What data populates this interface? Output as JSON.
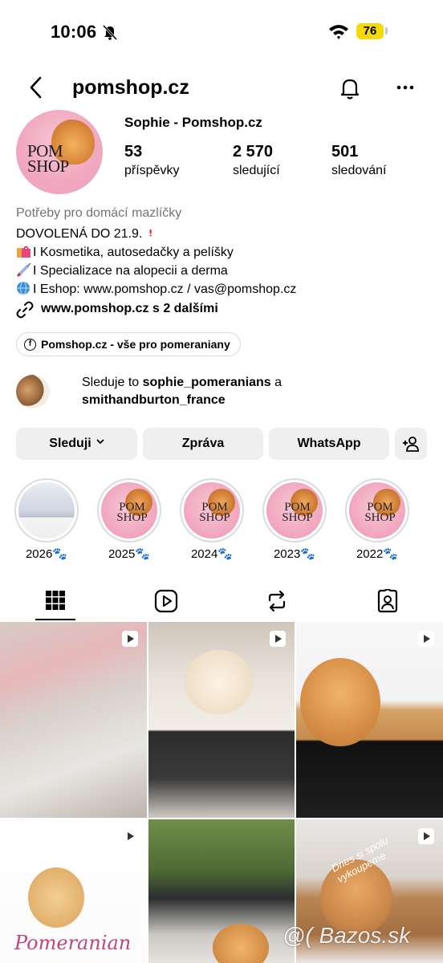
{
  "status_bar": {
    "time": "10:06",
    "battery": "76"
  },
  "header": {
    "username": "pomshop.cz"
  },
  "profile": {
    "avatar_text": "POM SHOP",
    "display_name": "Sophie - Pomshop.cz",
    "stats": [
      {
        "num": "53",
        "label": "příspěvky"
      },
      {
        "num": "2 570",
        "label": "sledující"
      },
      {
        "num": "501",
        "label": "sledování"
      }
    ]
  },
  "bio": {
    "category": "Potřeby pro domácí mazlíčky",
    "lines": [
      "DOVOLENÁ DO 21.9.",
      "I Kosmetika, autosedačky a pelíšky",
      "I Specializace na alopecii a derma",
      "I Eshop: www.pomshop.cz / vas@pomshop.cz"
    ],
    "emoji": [
      "exclamation-emoji",
      "shopping-bags-emoji",
      "syringe-emoji",
      "globe-emoji"
    ],
    "link": "www.pomshop.cz s 2 dalšími",
    "facebook_chip": "Pomshop.cz - vše pro pomeraniany"
  },
  "followed_by": {
    "prefix": "Sleduje to ",
    "user1": "sophie_pomeranians",
    "middle": " a",
    "user2": "smithandburton_france"
  },
  "actions": {
    "follow": "Sleduji",
    "message": "Zpráva",
    "whatsapp": "WhatsApp"
  },
  "highlights": [
    {
      "label": "2026🐾"
    },
    {
      "label": "2025🐾"
    },
    {
      "label": "2024🐾"
    },
    {
      "label": "2023🐾"
    },
    {
      "label": "2022🐾"
    }
  ],
  "highlight_logo": "POM SHOP",
  "tabs": [
    "grid-icon",
    "reels-icon",
    "reposts-icon",
    "tagged-icon"
  ],
  "posts": {
    "post4_text": "Pomeranian",
    "post6_text": "Dnes si spolu vykoupeme"
  },
  "watermark": "@( Bazos.sk",
  "colors": {
    "accent_text": "#737373",
    "button_bg": "#efefef",
    "battery": "#f5d90a"
  }
}
